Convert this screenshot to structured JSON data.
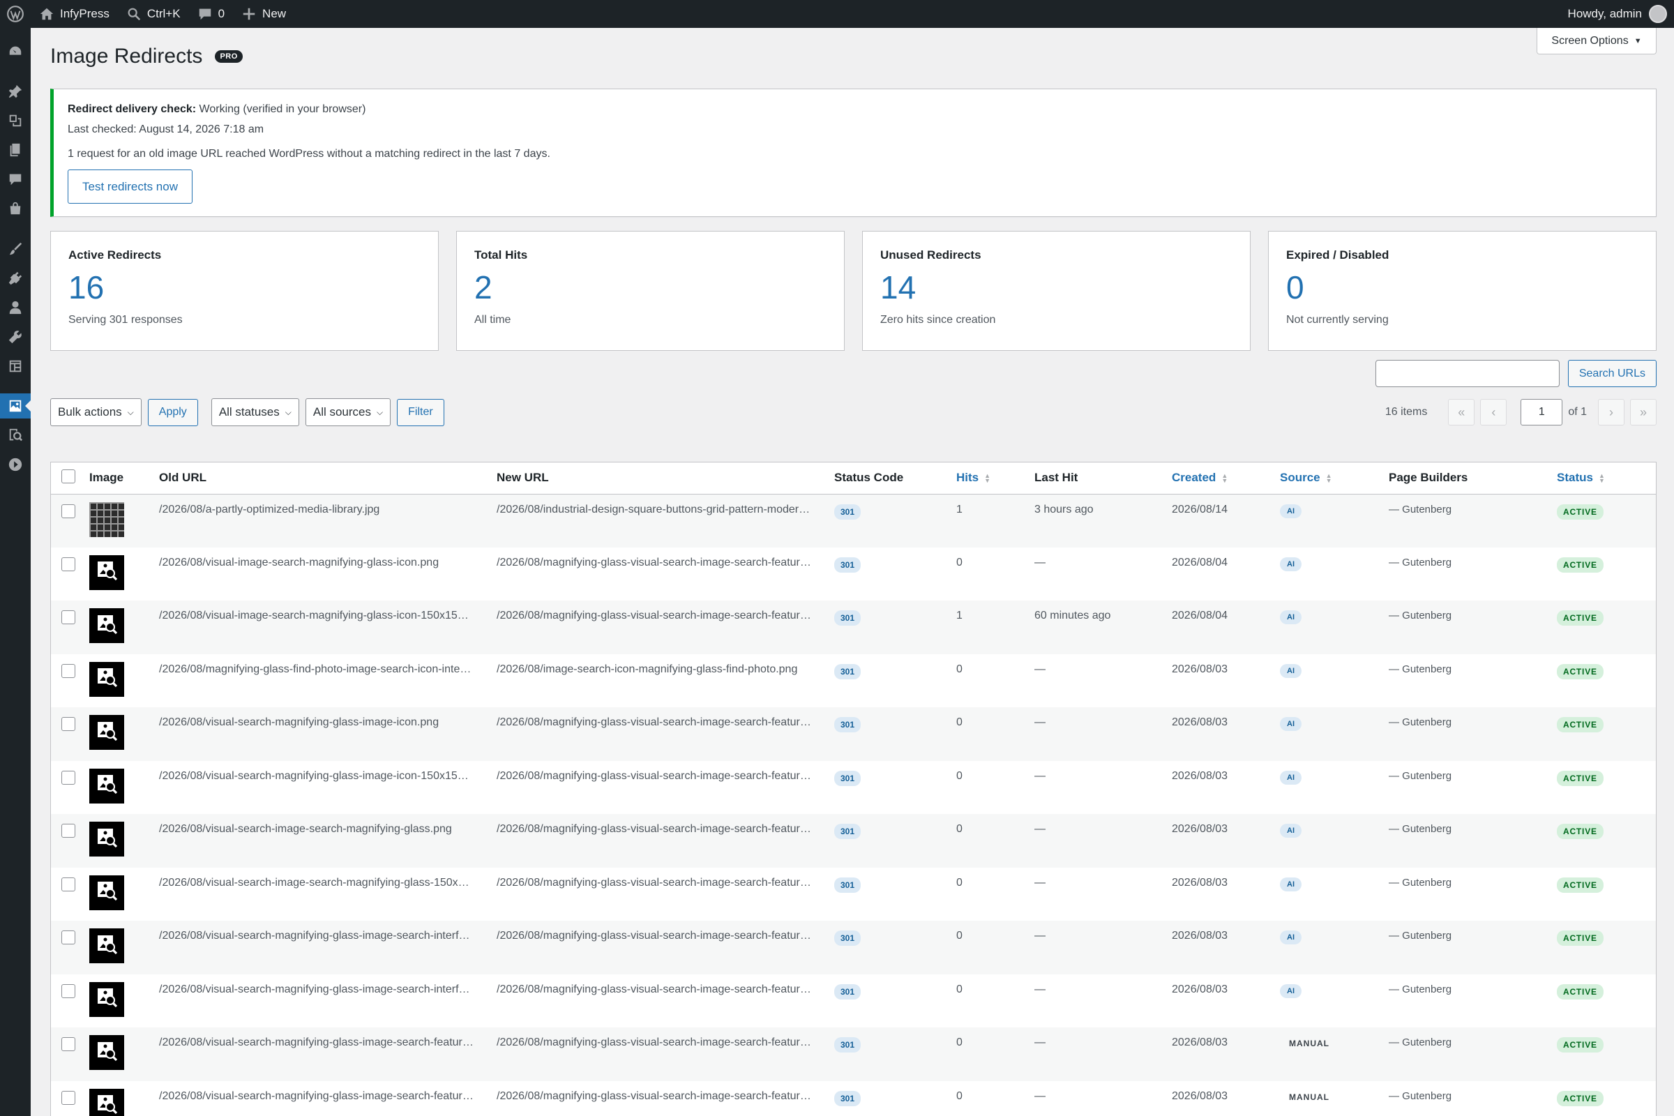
{
  "adminbar": {
    "site_name": "InfyPress",
    "search_label": "Ctrl+K",
    "comments_count": "0",
    "new_label": "New",
    "howdy": "Howdy, admin"
  },
  "page": {
    "title": "Image Redirects",
    "badge": "PRO",
    "screen_options": "Screen Options"
  },
  "notice": {
    "check_label": "Redirect delivery check:",
    "check_status": "Working (verified in your browser)",
    "last_checked": "Last checked: August 14, 2026 7:18 am",
    "message": "1 request for an old image URL reached WordPress without a matching redirect in the last 7 days.",
    "button": "Test redirects now"
  },
  "stats": [
    {
      "label": "Active Redirects",
      "value": "16",
      "sub": "Serving 301 responses"
    },
    {
      "label": "Total Hits",
      "value": "2",
      "sub": "All time"
    },
    {
      "label": "Unused Redirects",
      "value": "14",
      "sub": "Zero hits since creation"
    },
    {
      "label": "Expired / Disabled",
      "value": "0",
      "sub": "Not currently serving"
    }
  ],
  "search": {
    "button": "Search URLs",
    "value": ""
  },
  "tablenav": {
    "bulk_actions": "Bulk actions",
    "apply": "Apply",
    "status_filter": "All statuses",
    "source_filter": "All sources",
    "filter": "Filter",
    "items": "16 items",
    "first": "«",
    "prev": "‹",
    "page": "1",
    "of": "of 1",
    "next": "›",
    "last": "»"
  },
  "columns": {
    "image": "Image",
    "old_url": "Old URL",
    "new_url": "New URL",
    "status_code": "Status Code",
    "hits": "Hits",
    "last_hit": "Last Hit",
    "created": "Created",
    "source": "Source",
    "page_builders": "Page Builders",
    "status": "Status"
  },
  "rows": [
    {
      "old": "/2026/08/a-partly-optimized-media-library.jpg",
      "new": "/2026/08/industrial-design-square-buttons-grid-pattern-moder…",
      "code": "301",
      "hits": "1",
      "last": "3 hours ago",
      "created": "2026/08/14",
      "source": "AI",
      "builder": "— Gutenberg",
      "status": "ACTIVE",
      "thumb": "grid"
    },
    {
      "old": "/2026/08/visual-image-search-magnifying-glass-icon.png",
      "new": "/2026/08/magnifying-glass-visual-search-image-search-featur…",
      "code": "301",
      "hits": "0",
      "last": "—",
      "created": "2026/08/04",
      "source": "AI",
      "builder": "— Gutenberg",
      "status": "ACTIVE",
      "thumb": "icon"
    },
    {
      "old": "/2026/08/visual-image-search-magnifying-glass-icon-150x15…",
      "new": "/2026/08/magnifying-glass-visual-search-image-search-featur…",
      "code": "301",
      "hits": "1",
      "last": "60 minutes ago",
      "created": "2026/08/04",
      "source": "AI",
      "builder": "— Gutenberg",
      "status": "ACTIVE",
      "thumb": "icon"
    },
    {
      "old": "/2026/08/magnifying-glass-find-photo-image-search-icon-inte…",
      "new": "/2026/08/image-search-icon-magnifying-glass-find-photo.png",
      "code": "301",
      "hits": "0",
      "last": "—",
      "created": "2026/08/03",
      "source": "AI",
      "builder": "— Gutenberg",
      "status": "ACTIVE",
      "thumb": "icon"
    },
    {
      "old": "/2026/08/visual-search-magnifying-glass-image-icon.png",
      "new": "/2026/08/magnifying-glass-visual-search-image-search-featur…",
      "code": "301",
      "hits": "0",
      "last": "—",
      "created": "2026/08/03",
      "source": "AI",
      "builder": "— Gutenberg",
      "status": "ACTIVE",
      "thumb": "icon"
    },
    {
      "old": "/2026/08/visual-search-magnifying-glass-image-icon-150x15…",
      "new": "/2026/08/magnifying-glass-visual-search-image-search-featur…",
      "code": "301",
      "hits": "0",
      "last": "—",
      "created": "2026/08/03",
      "source": "AI",
      "builder": "— Gutenberg",
      "status": "ACTIVE",
      "thumb": "icon"
    },
    {
      "old": "/2026/08/visual-search-image-search-magnifying-glass.png",
      "new": "/2026/08/magnifying-glass-visual-search-image-search-featur…",
      "code": "301",
      "hits": "0",
      "last": "—",
      "created": "2026/08/03",
      "source": "AI",
      "builder": "— Gutenberg",
      "status": "ACTIVE",
      "thumb": "icon"
    },
    {
      "old": "/2026/08/visual-search-image-search-magnifying-glass-150x…",
      "new": "/2026/08/magnifying-glass-visual-search-image-search-featur…",
      "code": "301",
      "hits": "0",
      "last": "—",
      "created": "2026/08/03",
      "source": "AI",
      "builder": "— Gutenberg",
      "status": "ACTIVE",
      "thumb": "icon"
    },
    {
      "old": "/2026/08/visual-search-magnifying-glass-image-search-interf…",
      "new": "/2026/08/magnifying-glass-visual-search-image-search-featur…",
      "code": "301",
      "hits": "0",
      "last": "—",
      "created": "2026/08/03",
      "source": "AI",
      "builder": "— Gutenberg",
      "status": "ACTIVE",
      "thumb": "icon"
    },
    {
      "old": "/2026/08/visual-search-magnifying-glass-image-search-interf…",
      "new": "/2026/08/magnifying-glass-visual-search-image-search-featur…",
      "code": "301",
      "hits": "0",
      "last": "—",
      "created": "2026/08/03",
      "source": "AI",
      "builder": "— Gutenberg",
      "status": "ACTIVE",
      "thumb": "icon"
    },
    {
      "old": "/2026/08/visual-search-magnifying-glass-image-search-featur…",
      "new": "/2026/08/magnifying-glass-visual-search-image-search-featur…",
      "code": "301",
      "hits": "0",
      "last": "—",
      "created": "2026/08/03",
      "source": "MANUAL",
      "builder": "— Gutenberg",
      "status": "ACTIVE",
      "thumb": "icon"
    },
    {
      "old": "/2026/08/visual-search-magnifying-glass-image-search-featur…",
      "new": "/2026/08/magnifying-glass-visual-search-image-search-featur…",
      "code": "301",
      "hits": "0",
      "last": "—",
      "created": "2026/08/03",
      "source": "MANUAL",
      "builder": "— Gutenberg",
      "status": "ACTIVE",
      "thumb": "icon"
    }
  ],
  "colors": {
    "accent": "#2271b1",
    "admin_bar": "#1d2327",
    "notice_success": "#00a32a",
    "active_bg": "#d5f0dc",
    "pill_bg": "#dbe9f5"
  },
  "icons": {
    "wp": "wordpress-logo-icon",
    "home": "home-icon",
    "search": "search-icon",
    "comments": "comment-icon",
    "new": "plus-icon"
  }
}
